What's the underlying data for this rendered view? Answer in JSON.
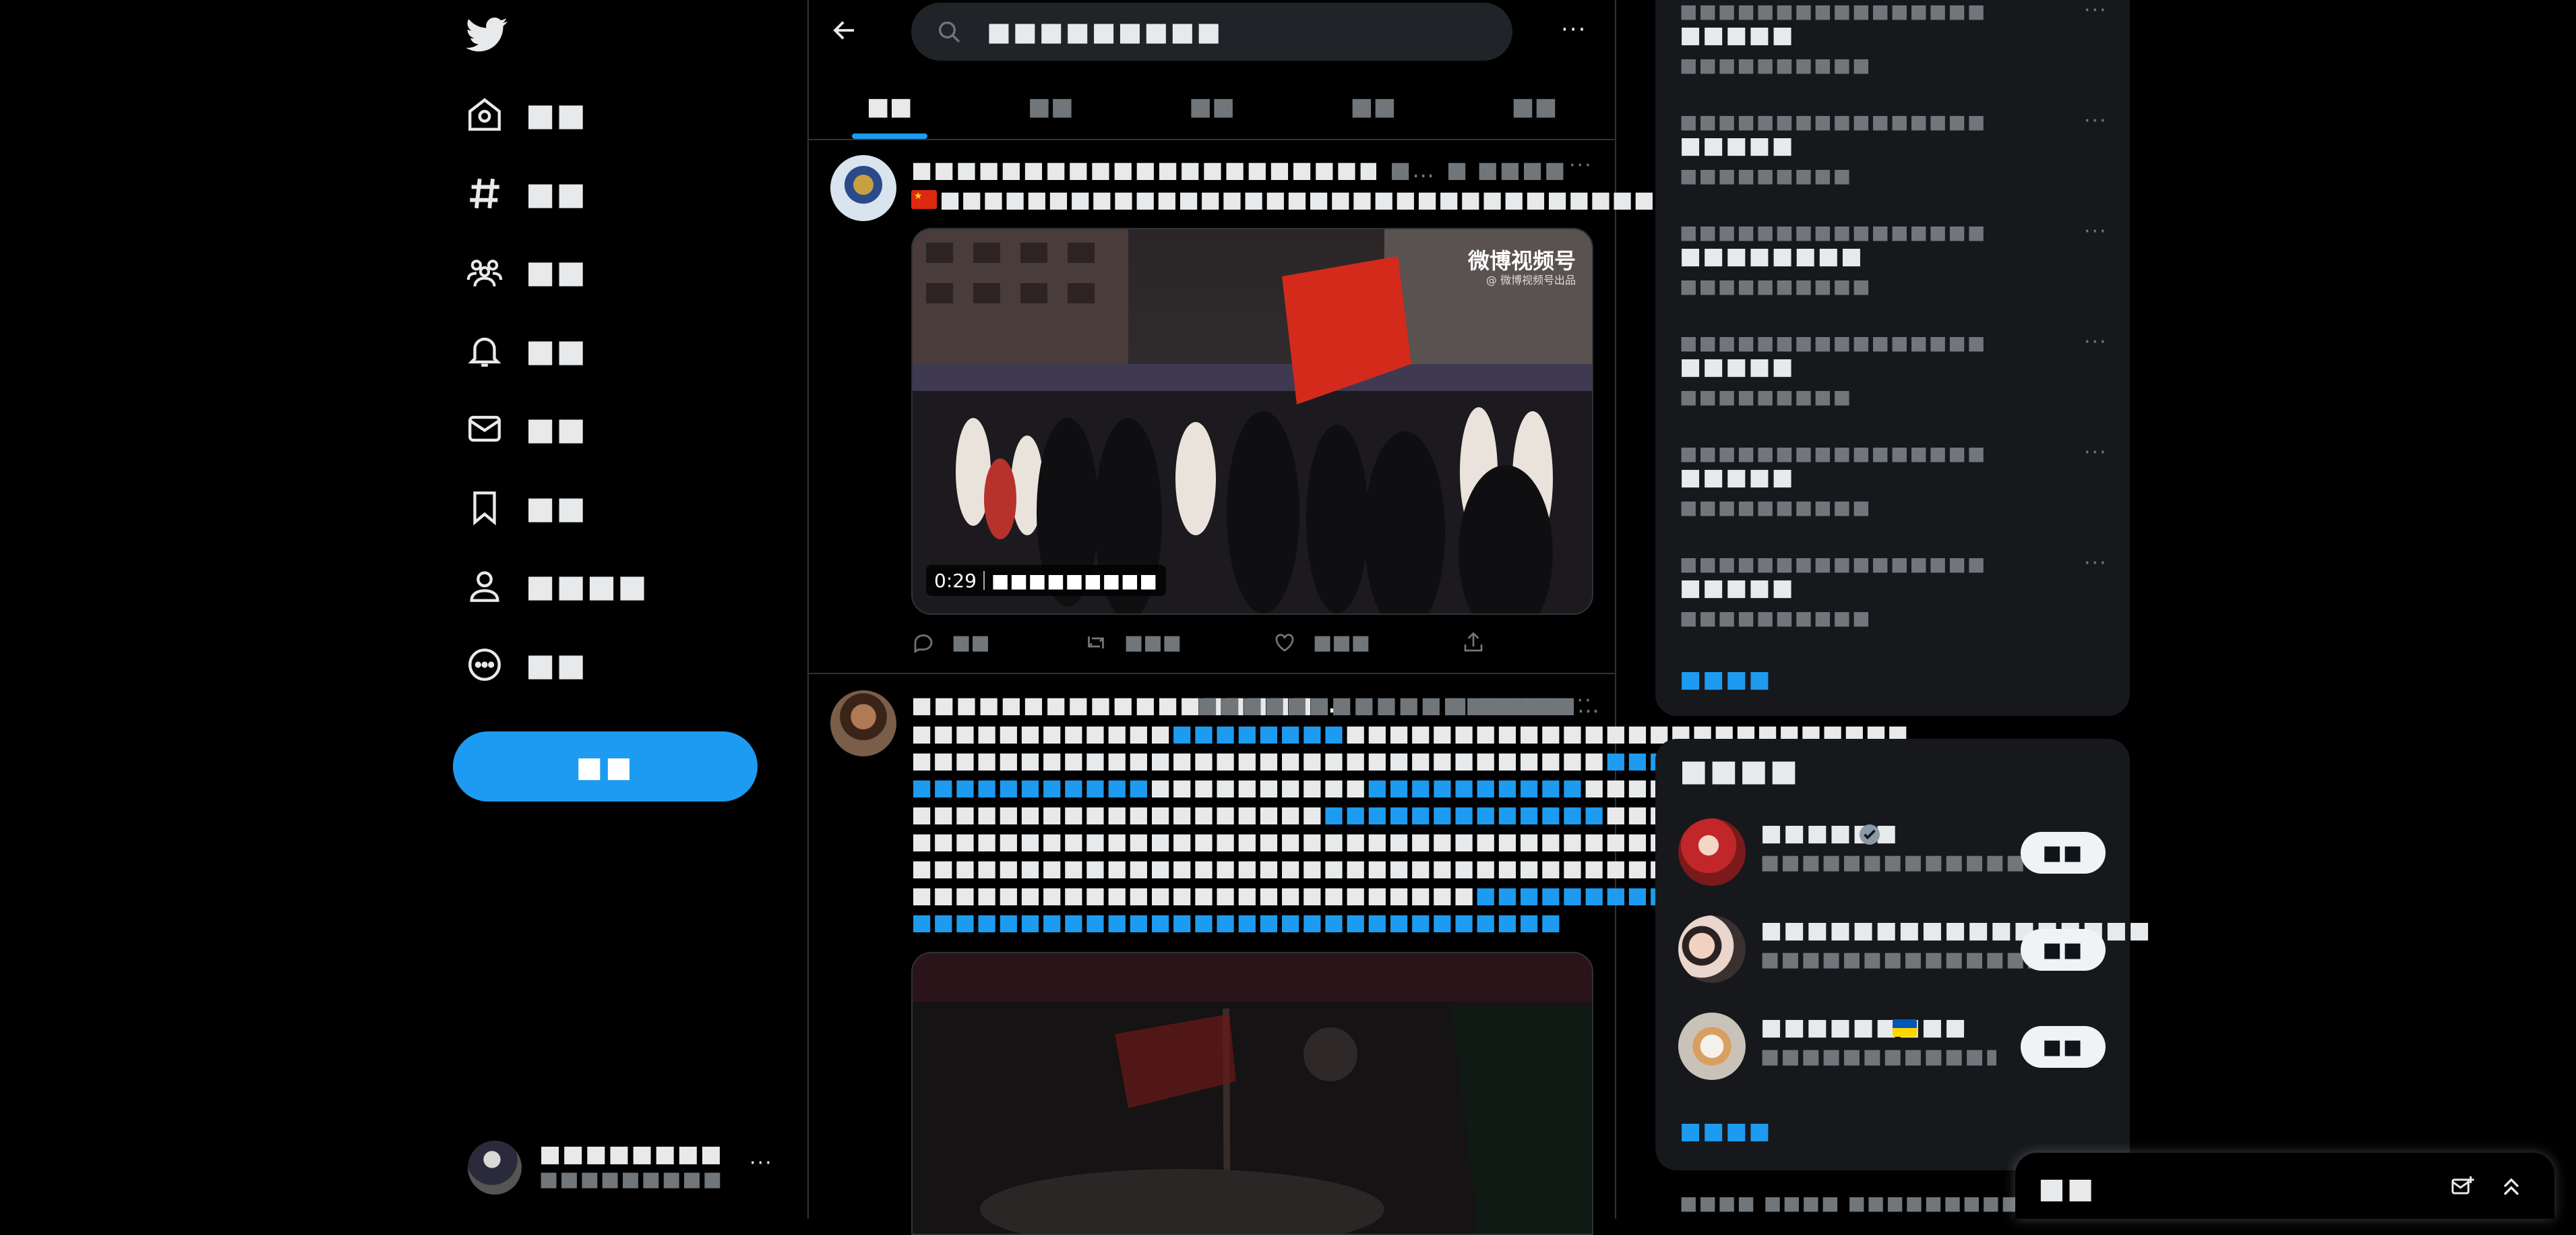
{
  "nav": {
    "items": [
      {
        "icon": "home-icon",
        "label": "■■"
      },
      {
        "icon": "hashtag-icon",
        "label": "■■"
      },
      {
        "icon": "communities-icon",
        "label": "■■"
      },
      {
        "icon": "bell-icon",
        "label": "■■"
      },
      {
        "icon": "mail-icon",
        "label": "■■"
      },
      {
        "icon": "bookmark-icon",
        "label": "■■"
      },
      {
        "icon": "profile-icon",
        "label": "■■■■"
      },
      {
        "icon": "more-circle-icon",
        "label": "■■"
      }
    ],
    "tweet_button": "■■",
    "account": {
      "name": "■■■■■■■■",
      "handle": "■■■■■■■■■"
    }
  },
  "search": {
    "query": "■■■■■■■■■"
  },
  "tabs": [
    "■■",
    "■■",
    "■■",
    "■■",
    "■■"
  ],
  "tweets": [
    {
      "name": "■■■■■■■■■■■■■■■■■■■■■■■■■■■…",
      "handle": "■…",
      "time": "■ ■■■■",
      "flag": "cn-flag",
      "text": "■■■■■■■■■■■■■■■■■■■■■■■■■■■■■■■■■■■■■■",
      "video_duration": "0:29",
      "video_label": "■■■■■■■■■",
      "watermark": "微博视频号",
      "watermark_sub": "@ 微博视频号出品",
      "replies": "■■",
      "retweets": "■■■",
      "likes": "■■■"
    },
    {
      "name": "■■■■■■■■■■■■■■■■■■…",
      "handle": "■■■■■■■■■■■■■■■■■…",
      "time": "■ ■■■■",
      "lines": [
        {
          "t": "■■■■■■■■■■■■",
          "l": "■■■■■■■■",
          "t2": "■■■■■■■■■■■■■■■■■■■■■■■■■■"
        },
        {
          "t": "■■■■■■■■■■■■■■■■■■■■■■■■■■■■■■■■",
          "l": "■■■■■■■■■■■■■■",
          "t2": "■",
          "l2": "■■■"
        },
        {
          "l": "■■■■■■■■■■■",
          "t": "■■■■■■■■■■",
          "l2": "■■■■■■■■■■",
          "t2": "■■■■■■■■■■■■■■■■■■■■"
        },
        {
          "t": "■■■■■■■■■■■■■■■■■■■",
          "l": "■■■■■■■■■■■■■",
          "t2": "■■■■■■■■■■■■■■■■■■■■"
        },
        {
          "t": "■■■■■■■■■■■■■■■■■■■■■■■■■■■■■■■■■■■■■■■■■■■■■■■■■■■"
        },
        {
          "t": "■■■■■■■■■■■■■■■■■■■■■■■■■■■■■■■■■■■■■■■■■■■■■■■■■■■"
        },
        {
          "t": "■■■■■■■■■■■■■■■■■■■■■■■■■■",
          "l": "■■■■■■■■■■■■■■■■■■■■■■■■",
          "t2": "■"
        },
        {
          "l": "■■■■■■■■■■■■■■■■■■■■■■■■■■■■■■"
        }
      ]
    }
  ],
  "trends": [
    {
      "category": "■■■■■■■■■■■■■■■■",
      "name": "■■■■■",
      "count": "■■■■■■■■■■",
      "top_only": true
    },
    {
      "category": "■■■■■■■■■■■■■■■■",
      "name": "■■■■■",
      "count": "■■■■■■■■■"
    },
    {
      "category": "■■■■■■■■■■■■■■■■",
      "name": "■■■■■■■■",
      "count": "■■■■■■■■■■"
    },
    {
      "category": "■■■■■■■■■■■■■■■■",
      "name": "■■■■■",
      "count": "■■■■■■■■■"
    },
    {
      "category": "■■■■■■■■■■■■■■■■",
      "name": "■■■■■",
      "count": "■■■■■■■■■■"
    },
    {
      "category": "■■■■■■■■■■■■■■■■",
      "name": "■■■■■",
      "count": "■■■■■■■■■■"
    }
  ],
  "trends_show_more": "■■■■",
  "who_to_follow": {
    "title": "■■■■",
    "accounts": [
      {
        "name": "■■■■■■",
        "handle": "■■■■■■■■■■■■■",
        "verified": true,
        "follow": "■■"
      },
      {
        "name": "■■■■■■■■■■■■■■■■■",
        "handle": "■■■■■■■■■■■■■■■■",
        "follow": "■■"
      },
      {
        "name": "■■■■■■■■■",
        "handle": "■■■■■■■■■■■■■■■■■…",
        "flag": "ua-flag",
        "follow": "■■"
      }
    ],
    "show_more": "■■■■"
  },
  "footer": "■■■■ ■■■■ ■■■■■■■■■■■ ■■",
  "messages": {
    "title": "■■"
  },
  "colors": {
    "accent": "#1d9bf0",
    "bg": "#000000",
    "panel": "#16181c",
    "text": "#e7e9ea",
    "muted": "#71767b"
  }
}
